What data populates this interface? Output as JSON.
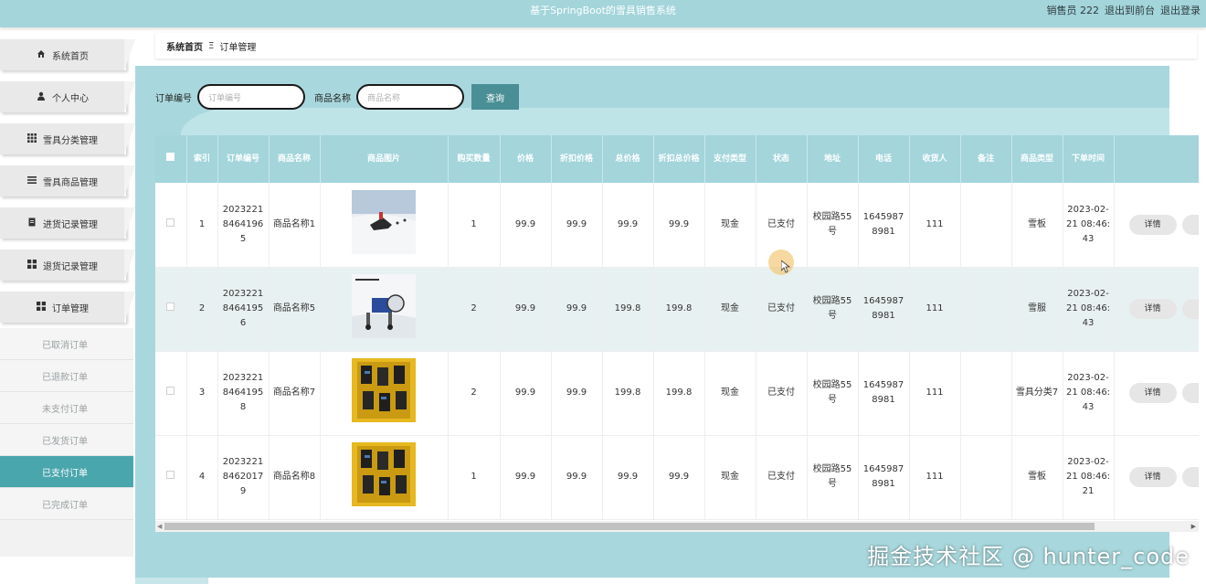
{
  "header": {
    "title": "基于SpringBoot的雪具销售系统",
    "user": "销售员 222",
    "back_to_front": "退出到前台",
    "logout": "退出登录"
  },
  "sidebar": {
    "items": [
      {
        "label": "系统首页",
        "icon": "home-icon"
      },
      {
        "label": "个人中心",
        "icon": "user-icon"
      },
      {
        "label": "雪具分类管理",
        "icon": "grid-icon"
      },
      {
        "label": "雪具商品管理",
        "icon": "list-icon"
      },
      {
        "label": "进货记录管理",
        "icon": "document-icon"
      },
      {
        "label": "退货记录管理",
        "icon": "apps-icon"
      },
      {
        "label": "订单管理",
        "icon": "apps-icon"
      }
    ],
    "sub_items": [
      {
        "label": "已取消订单"
      },
      {
        "label": "已退款订单"
      },
      {
        "label": "未支付订单"
      },
      {
        "label": "已发货订单"
      },
      {
        "label": "已支付订单",
        "active": true
      },
      {
        "label": "已完成订单"
      }
    ]
  },
  "breadcrumb": {
    "home": "系统首页",
    "separator": "Ξ",
    "current": "订单管理"
  },
  "search": {
    "order_label": "订单编号",
    "order_placeholder": "订单编号",
    "product_label": "商品名称",
    "product_placeholder": "商品名称",
    "button": "查询"
  },
  "table": {
    "headers": [
      "索引",
      "订单编号",
      "商品名称",
      "商品图片",
      "购买数量",
      "价格",
      "折扣价格",
      "总价格",
      "折扣总价格",
      "支付类型",
      "状态",
      "地址",
      "电话",
      "收货人",
      "备注",
      "商品类型",
      "下单时间"
    ],
    "rows": [
      {
        "index": "1",
        "order_no": "20232218464196 5",
        "product": "商品名称1",
        "image": "snowmobile-photo",
        "qty": "1",
        "price": "99.9",
        "discount_price": "99.9",
        "total": "99.9",
        "discount_total": "99.9",
        "pay_type": "现金",
        "status": "已支付",
        "address": "校园路55号",
        "phone": "16459878981",
        "receiver": "111",
        "note": "",
        "type": "雪板",
        "time": "2023-02-21 08:46:43",
        "action": "详情"
      },
      {
        "index": "2",
        "order_no": "20232218464195 6",
        "product": "商品名称5",
        "image": "snow-machine-photo",
        "qty": "2",
        "price": "99.9",
        "discount_price": "99.9",
        "total": "199.8",
        "discount_total": "199.8",
        "pay_type": "现金",
        "status": "已支付",
        "address": "校园路55号",
        "phone": "16459878981",
        "receiver": "111",
        "note": "",
        "type": "雪服",
        "time": "2023-02-21 08:46:43",
        "action": "详情"
      },
      {
        "index": "3",
        "order_no": "20232218464195 8",
        "product": "商品名称7",
        "image": "ski-boots-photo",
        "qty": "2",
        "price": "99.9",
        "discount_price": "99.9",
        "total": "199.8",
        "discount_total": "199.8",
        "pay_type": "现金",
        "status": "已支付",
        "address": "校园路55号",
        "phone": "16459878981",
        "receiver": "111",
        "note": "",
        "type": "雪具分类7",
        "time": "2023-02-21 08:46:43",
        "action": "详情"
      },
      {
        "index": "4",
        "order_no": "20232218462017 9",
        "product": "商品名称8",
        "image": "ski-boots-photo",
        "qty": "1",
        "price": "99.9",
        "discount_price": "99.9",
        "total": "99.9",
        "discount_total": "99.9",
        "pay_type": "现金",
        "status": "已支付",
        "address": "校园路55号",
        "phone": "16459878981",
        "receiver": "111",
        "note": "",
        "type": "雪板",
        "time": "2023-02-21 08:46:21",
        "action": "详情"
      }
    ]
  },
  "watermark": "掘金技术社区 @ hunter_code",
  "colors": {
    "accent": "#a3d5db",
    "button": "#4a8f95",
    "active_menu": "#4aa6ad"
  }
}
